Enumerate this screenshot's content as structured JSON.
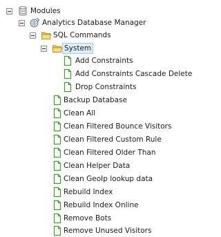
{
  "tree": {
    "modules": {
      "label": "Modules",
      "icon": "modules-db-icon",
      "expanded": true
    },
    "analytics": {
      "label": "Analytics Database Manager",
      "icon": "analytics-globe-icon",
      "expanded": true
    },
    "sql_commands": {
      "label": "SQL Commands",
      "icon": "folder-icon",
      "expanded": true
    },
    "system": {
      "label": "System",
      "icon": "folder-icon",
      "expanded": true,
      "selected": true
    },
    "system_children": [
      {
        "label": "Add Constraints",
        "icon": "document-icon"
      },
      {
        "label": "Add Constraints Cascade Delete",
        "icon": "document-icon"
      },
      {
        "label": "Drop Constraints",
        "icon": "document-icon"
      }
    ],
    "commands": [
      {
        "label": "Backup Database",
        "icon": "document-icon"
      },
      {
        "label": "Clean All",
        "icon": "document-icon"
      },
      {
        "label": "Clean Filtered Bounce Visitors",
        "icon": "document-icon"
      },
      {
        "label": "Clean Filtered Custom Rule",
        "icon": "document-icon"
      },
      {
        "label": "Clean Filtered Older Than",
        "icon": "document-icon"
      },
      {
        "label": "Clean Helper Data",
        "icon": "document-icon"
      },
      {
        "label": "Clean GeoIp lookup data",
        "icon": "document-icon"
      },
      {
        "label": "Rebuild Index",
        "icon": "document-icon"
      },
      {
        "label": "Rebuild Index Online",
        "icon": "document-icon"
      },
      {
        "label": "Remove Bots",
        "icon": "document-icon"
      },
      {
        "label": "Remove Unused Visitors",
        "icon": "document-icon"
      }
    ]
  },
  "colors": {
    "selection_bg": "#ddeefa",
    "selection_border": "#a8cbe8",
    "document_green": "#3f9a2e",
    "folder_yellow": "#f2c94c"
  }
}
